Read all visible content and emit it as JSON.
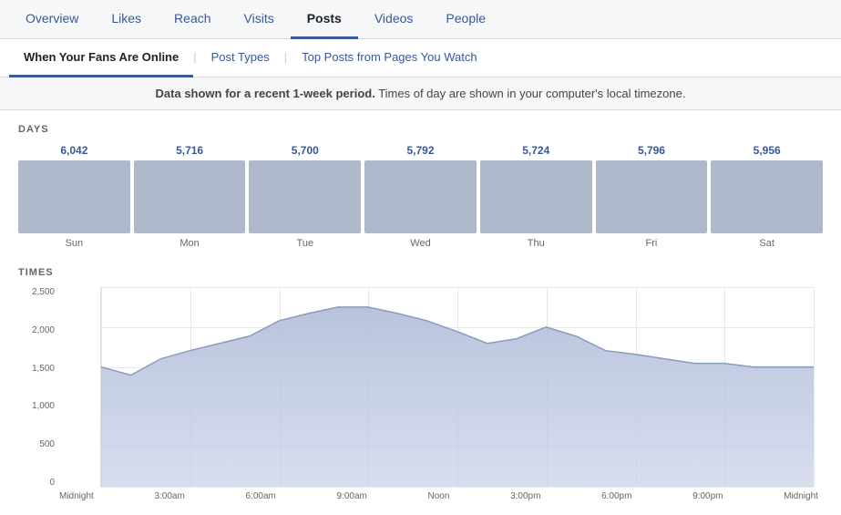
{
  "topNav": {
    "items": [
      {
        "label": "Overview",
        "active": false
      },
      {
        "label": "Likes",
        "active": false
      },
      {
        "label": "Reach",
        "active": false
      },
      {
        "label": "Visits",
        "active": false
      },
      {
        "label": "Posts",
        "active": true
      },
      {
        "label": "Videos",
        "active": false
      },
      {
        "label": "People",
        "active": false
      }
    ]
  },
  "subNav": {
    "items": [
      {
        "label": "When Your Fans Are Online",
        "active": true
      },
      {
        "label": "Post Types",
        "active": false
      },
      {
        "label": "Top Posts from Pages You Watch",
        "active": false
      }
    ]
  },
  "infoBar": {
    "text": "Data shown for a recent 1-week period. Times of day are shown in your computer's local timezone."
  },
  "daysSection": {
    "label": "DAYS",
    "days": [
      {
        "name": "Sun",
        "value": "6,042"
      },
      {
        "name": "Mon",
        "value": "5,716"
      },
      {
        "name": "Tue",
        "value": "5,700"
      },
      {
        "name": "Wed",
        "value": "5,792"
      },
      {
        "name": "Thu",
        "value": "5,724"
      },
      {
        "name": "Fri",
        "value": "5,796"
      },
      {
        "name": "Sat",
        "value": "5,956"
      }
    ]
  },
  "timesSection": {
    "label": "TIMES",
    "yLabels": [
      "2,500",
      "2,000",
      "1,500",
      "1,000",
      "500",
      "0"
    ],
    "xLabels": [
      "Midnight",
      "3:00am",
      "6:00am",
      "9:00am",
      "Noon",
      "3:00pm",
      "6:00pm",
      "9:00pm",
      "Midnight"
    ]
  }
}
